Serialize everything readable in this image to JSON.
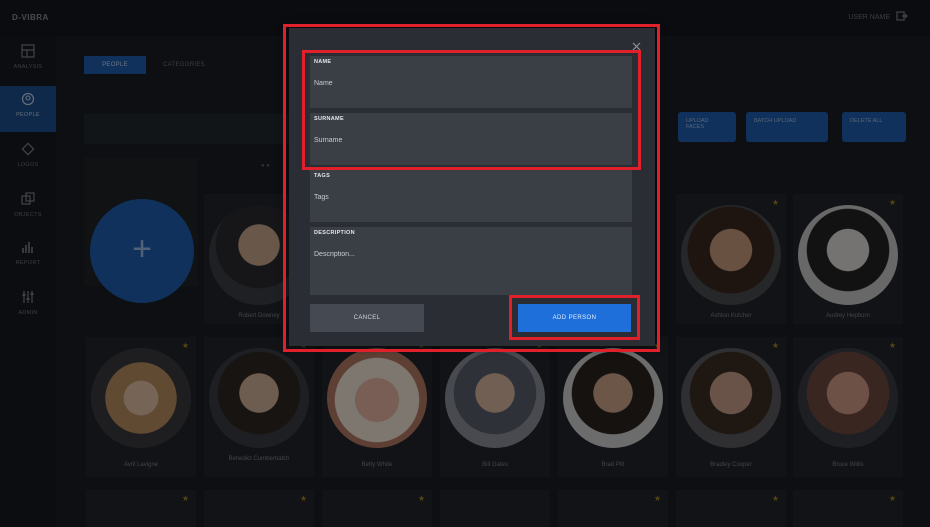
{
  "app": {
    "brand": "D-VIBRA",
    "top_right_text": "USER NAME"
  },
  "sidebar": {
    "items": [
      {
        "label": "ANALYSIS",
        "icon": "dashboard-icon",
        "active": false
      },
      {
        "label": "PEOPLE",
        "icon": "people-icon",
        "active": true
      },
      {
        "label": "LOGOS",
        "icon": "logos-icon",
        "active": false
      },
      {
        "label": "OBJECTS",
        "icon": "objects-icon",
        "active": false
      },
      {
        "label": "REPORT",
        "icon": "report-icon",
        "active": false
      },
      {
        "label": "ADMIN",
        "icon": "admin-icon",
        "active": false
      }
    ]
  },
  "tabs": [
    "PEOPLE",
    "CATEGORIES"
  ],
  "actions": {
    "upload_faces": "UPLOAD FACES",
    "batch_upload": "BATCH UPLOAD",
    "delete_all": "DELETE ALL"
  },
  "people": {
    "row1": [
      {
        "name": "Robert Downey"
      },
      {
        "name": "Ashton Kutcher"
      },
      {
        "name": "Audrey Hepburn"
      }
    ],
    "row2": [
      {
        "name": "Avril Lavigne"
      },
      {
        "name": "Benedict Cumberbatch"
      },
      {
        "name": "Betty White"
      },
      {
        "name": "Bill Gates"
      },
      {
        "name": "Brad Pitt"
      },
      {
        "name": "Bradley Cooper"
      },
      {
        "name": "Bruce Willis"
      }
    ]
  },
  "modal": {
    "name": {
      "label": "NAME",
      "placeholder": "Name"
    },
    "surname": {
      "label": "SURNAME",
      "placeholder": "Surname"
    },
    "tags": {
      "label": "TAGS",
      "placeholder": "Tags"
    },
    "description": {
      "label": "DESCRIPTION",
      "placeholder": "Description..."
    },
    "cancel_label": "CANCEL",
    "add_label": "ADD PERSON"
  },
  "colors": {
    "accent": "#1e6fd9",
    "highlight": "#e0212b",
    "star": "#a5852a"
  }
}
